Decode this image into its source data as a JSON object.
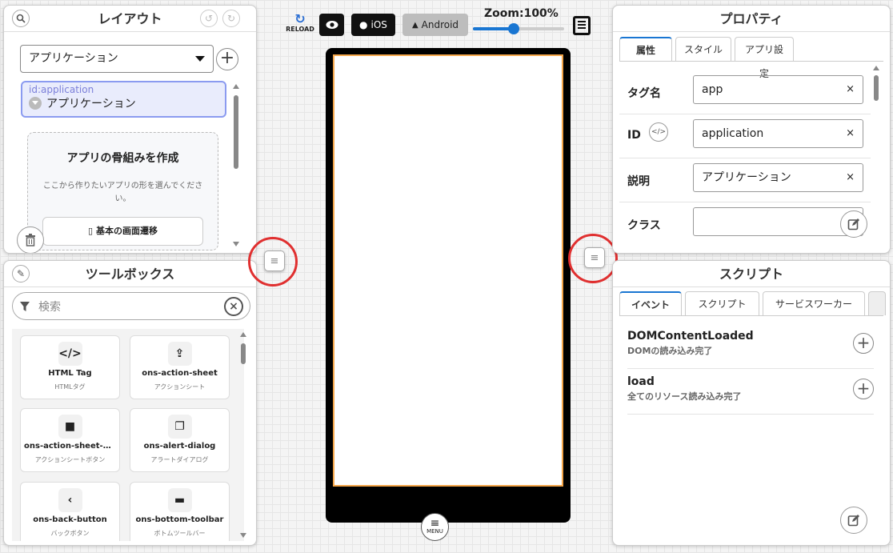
{
  "layout_panel": {
    "title": "レイアウト",
    "select_value": "アプリケーション",
    "tree": {
      "id": "id:application",
      "label": "アプリケーション"
    },
    "empty": {
      "title": "アプリの骨組みを作成",
      "desc": "ここから作りたいアプリの形を選んでください。",
      "button": "基本の画面遷移"
    }
  },
  "toolbox": {
    "title": "ツールボックス",
    "search_placeholder": "検索",
    "tools": [
      {
        "icon": "</>",
        "name": "HTML Tag",
        "sub": "HTMLタグ"
      },
      {
        "icon": "⇪",
        "name": "ons-action-sheet",
        "sub": "アクションシート"
      },
      {
        "icon": "■",
        "name": "ons-action-sheet-bu…",
        "sub": "アクションシートボタン"
      },
      {
        "icon": "❐",
        "name": "ons-alert-dialog",
        "sub": "アラートダイアログ"
      },
      {
        "icon": "‹",
        "name": "ons-back-button",
        "sub": "バックボタン"
      },
      {
        "icon": "▬",
        "name": "ons-bottom-toolbar",
        "sub": "ボトムツールバー"
      }
    ]
  },
  "toolbar": {
    "reload": "RELOAD",
    "ios": "iOS",
    "android": "Android",
    "zoom_label": "Zoom:100%",
    "zoom_fraction": 0.45
  },
  "menu_label": "MENU",
  "props": {
    "title": "プロパティ",
    "tabs": [
      "属性",
      "スタイル",
      "アプリ設定"
    ],
    "rows": [
      {
        "label": "タグ名",
        "value": "app"
      },
      {
        "label": "ID",
        "value": "application"
      },
      {
        "label": "説明",
        "value": "アプリケーション"
      },
      {
        "label": "クラス",
        "value": ""
      }
    ]
  },
  "script": {
    "title": "スクリプト",
    "tabs": [
      "イベント",
      "スクリプト",
      "サービスワーカー"
    ],
    "events": [
      {
        "name": "DOMContentLoaded",
        "desc": "DOMの読み込み完了"
      },
      {
        "name": "load",
        "desc": "全てのリソース読み込み完了"
      }
    ]
  }
}
